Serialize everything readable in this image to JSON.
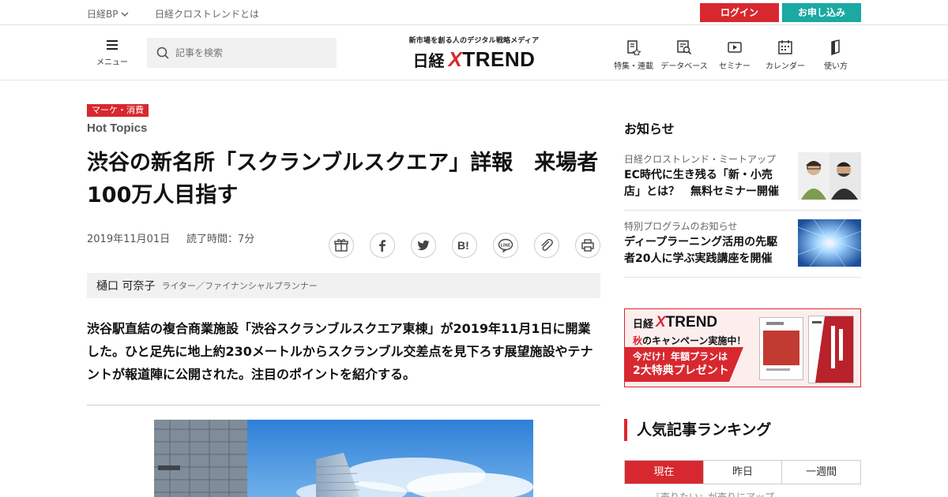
{
  "topbar": {
    "bp_label": "日経BP",
    "about_label": "日経クロストレンドとは",
    "login_label": "ログイン",
    "signup_label": "お申し込み"
  },
  "header": {
    "menu_label": "メニュー",
    "search_placeholder": "記事を検索",
    "tagline": "新市場を創る人のデジタル戦略メディア",
    "logo_nikkei": "日経",
    "logo_x": "X",
    "logo_trend": "TREND",
    "nav": [
      {
        "label": "特集・連載",
        "icon": "feature-icon"
      },
      {
        "label": "データベース",
        "icon": "database-icon"
      },
      {
        "label": "セミナー",
        "icon": "seminar-icon"
      },
      {
        "label": "カレンダー",
        "icon": "calendar-icon"
      },
      {
        "label": "使い方",
        "icon": "guide-icon"
      }
    ]
  },
  "article": {
    "category": "マーケ・消費",
    "section": "Hot Topics",
    "title": "渋谷の新名所「スクランブルスクエア」詳報　来場者100万人目指す",
    "date": "2019年11月01日",
    "read_time": "読了時間：7分",
    "share": [
      "gift-icon",
      "facebook-icon",
      "twitter-icon",
      "hatena-icon",
      "line-icon",
      "link-icon",
      "print-icon"
    ],
    "author_name": "樋口 可奈子",
    "author_role": "ライター／ファイナンシャルプランナー",
    "lead": "渋谷駅直結の複合商業施設「渋谷スクランブルスクエア東棟」が2019年11月1日に開業した。ひと足先に地上約230メートルからスクランブル交差点を見下ろす展望施設やテナントが報道陣に公開された。注目のポイントを紹介する。"
  },
  "sidebar": {
    "notice_title": "お知らせ",
    "news": [
      {
        "sub": "日経クロストレンド・ミートアップ",
        "head": "EC時代に生き残る「新・小売店」とは？　無料セミナー開催"
      },
      {
        "sub": "特別プログラムのお知らせ",
        "head": "ディープラーニング活用の先駆者20人に学ぶ実践講座を開催"
      }
    ],
    "banner": {
      "logo_nikkei": "日経",
      "logo_x": "X",
      "logo_trend": "TREND",
      "camp_accent": "秋",
      "camp_rest": "のキャンペーン実施中！",
      "promo_line1": "今だけ！年額プランは",
      "promo_line2": "2大特典プレゼント"
    },
    "ranking_title": "人気記事ランキング",
    "tabs": [
      "現在",
      "昨日",
      "一週間"
    ],
    "active_tab": 0,
    "cut_text": "『売りたい』が売りにアップ"
  },
  "colors": {
    "brand_red": "#d8282f",
    "teal": "#1aa9a3"
  }
}
